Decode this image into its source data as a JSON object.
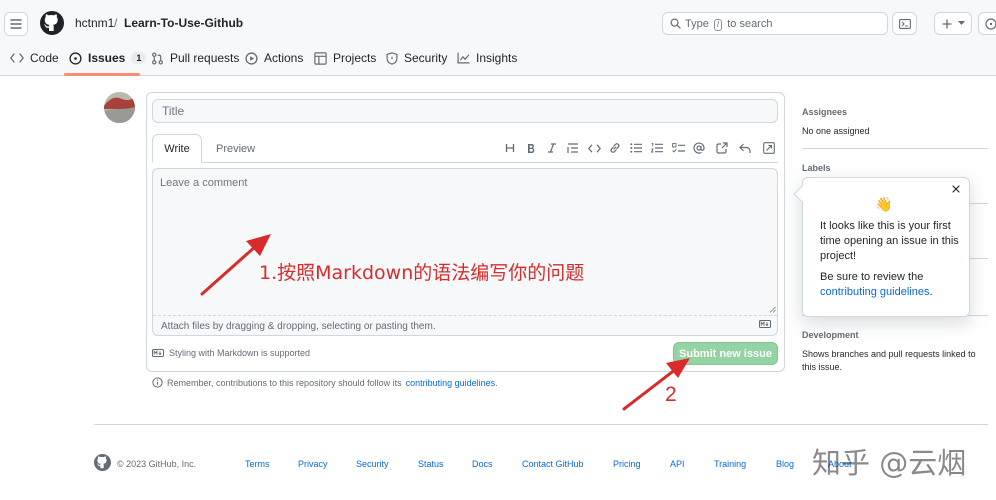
{
  "header": {
    "owner": "hctnm1",
    "separator": "/",
    "repo": "Learn-To-Use-Github",
    "search": {
      "prefix": "Type",
      "key": "/",
      "suffix": "to search"
    },
    "icons": [
      "hamburger-icon",
      "github-logo-icon",
      "search-icon",
      "command-palette-icon",
      "plus-icon",
      "chevron-down-icon",
      "issues-icon"
    ]
  },
  "nav": {
    "tabs": [
      {
        "label": "Code",
        "icon": "code-icon"
      },
      {
        "label": "Issues",
        "icon": "issue-opened-icon",
        "count": "1",
        "active": true
      },
      {
        "label": "Pull requests",
        "icon": "git-pull-request-icon"
      },
      {
        "label": "Actions",
        "icon": "play-icon"
      },
      {
        "label": "Projects",
        "icon": "table-icon"
      },
      {
        "label": "Security",
        "icon": "shield-icon"
      },
      {
        "label": "Insights",
        "icon": "graph-icon"
      }
    ]
  },
  "form": {
    "title_placeholder": "Title",
    "write_tab": "Write",
    "preview_tab": "Preview",
    "comment_placeholder": "Leave a comment",
    "attach_text": "Attach files by dragging & dropping, selecting or pasting them.",
    "markdown_note": "Styling with Markdown is supported",
    "submit_label": "Submit new issue",
    "remember_prefix": "Remember, contributions to this repository should follow its",
    "remember_link": "contributing guidelines",
    "remember_suffix": ".",
    "toolbar_icons": [
      "heading-icon",
      "bold-icon",
      "italic-icon",
      "quote-icon",
      "code-icon",
      "link-icon",
      "unordered-list-icon",
      "ordered-list-icon",
      "task-list-icon",
      "mention-icon",
      "cross-reference-icon",
      "reply-icon",
      "fullscreen-icon"
    ]
  },
  "sidebar": {
    "assignees_heading": "Assignees",
    "assignees_value": "No one assigned",
    "labels_heading": "Labels",
    "development_heading": "Development",
    "development_text": "Shows branches and pull requests linked to this issue."
  },
  "popover": {
    "emoji": "👋",
    "text1": "It looks like this is your first time opening an issue in this project!",
    "text2_prefix": "Be sure to review the",
    "text2_link": "contributing guidelines",
    "text2_suffix": "."
  },
  "annotations": {
    "step1": "1.按照Markdown的语法编写你的问题",
    "step2": "2",
    "color": "#d92b2b"
  },
  "footer": {
    "copyright": "© 2023 GitHub, Inc.",
    "links": [
      "Terms",
      "Privacy",
      "Security",
      "Status",
      "Docs",
      "Contact GitHub",
      "Pricing",
      "API",
      "Training",
      "Blog",
      "About"
    ]
  },
  "watermark": "知乎 @云烟",
  "colors": {
    "accent": "#0969da",
    "submit": "#94d3a2",
    "tab_underline": "#fd8c73",
    "border": "#d0d7de"
  }
}
